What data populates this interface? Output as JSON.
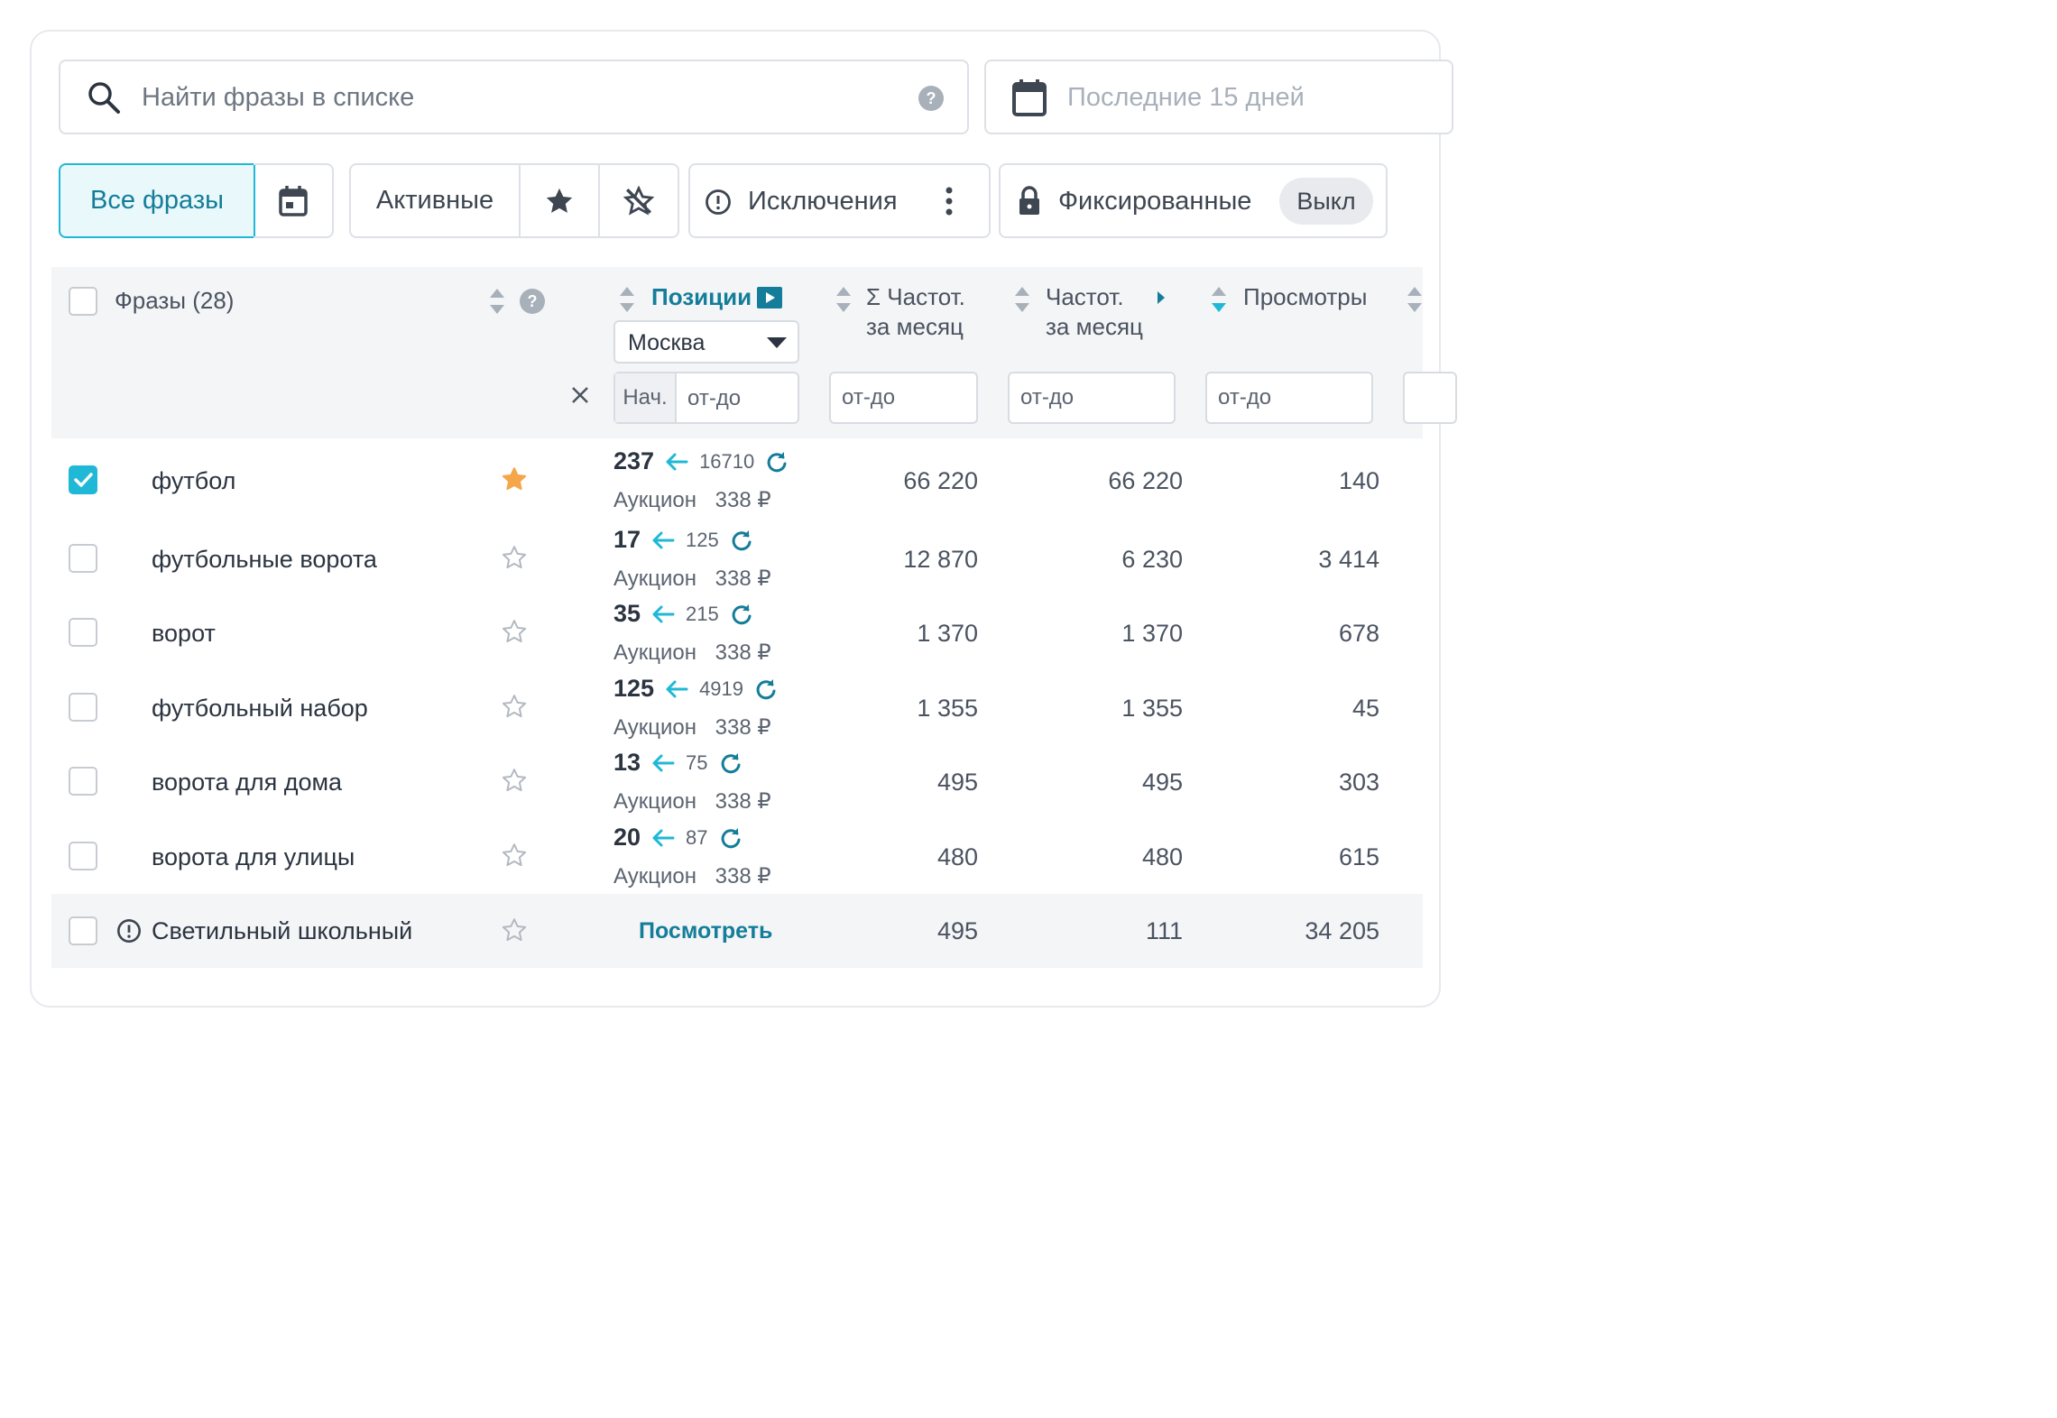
{
  "search": {
    "placeholder": "Найти фразы в списке"
  },
  "date_filter": {
    "label": "Последние 15 дней"
  },
  "filters": {
    "all_phrases": "Все фразы",
    "active": "Активные",
    "exclusions": "Исключения",
    "fixed": "Фиксированные",
    "fixed_state": "Выкл"
  },
  "colors": {
    "accent": "#147d9a",
    "cyan": "#1fb8d6",
    "star_active": "#f5a64a",
    "header_bg": "#f4f5f7"
  },
  "table": {
    "headers": {
      "phrases": "Фразы (28)",
      "positions": "Позиции",
      "region": "Москва",
      "start_label": "Нач.",
      "range_placeholder": "от-до",
      "freq_total_line1": "Σ Частот.",
      "freq_total_line2": "за месяц",
      "freq_line1": "Частот.",
      "freq_line2": "за месяц",
      "views": "Просмотры"
    },
    "rows": [
      {
        "phrase": "футбол",
        "checked": true,
        "starred": true,
        "pos": "237",
        "prev": "16710",
        "auction_label": "Аукцион",
        "auction_price": "338 ₽",
        "freq_total": "66 220",
        "freq": "66 220",
        "views": "140"
      },
      {
        "phrase": "футбольные ворота",
        "checked": false,
        "starred": false,
        "pos": "17",
        "prev": "125",
        "auction_label": "Аукцион",
        "auction_price": "338 ₽",
        "freq_total": "12 870",
        "freq": "6 230",
        "views": "3 414"
      },
      {
        "phrase": "ворот",
        "checked": false,
        "starred": false,
        "pos": "35",
        "prev": "215",
        "auction_label": "Аукцион",
        "auction_price": "338 ₽",
        "freq_total": "1 370",
        "freq": "1 370",
        "views": "678"
      },
      {
        "phrase": "футбольный набор",
        "checked": false,
        "starred": false,
        "pos": "125",
        "prev": "4919",
        "auction_label": "Аукцион",
        "auction_price": "338 ₽",
        "freq_total": "1 355",
        "freq": "1 355",
        "views": "45"
      },
      {
        "phrase": "ворота для дома",
        "checked": false,
        "starred": false,
        "pos": "13",
        "prev": "75",
        "auction_label": "Аукцион",
        "auction_price": "338 ₽",
        "freq_total": "495",
        "freq": "495",
        "views": "303"
      },
      {
        "phrase": "ворота для улицы",
        "checked": false,
        "starred": false,
        "pos": "20",
        "prev": "87",
        "auction_label": "Аукцион",
        "auction_price": "338 ₽",
        "freq_total": "480",
        "freq": "480",
        "views": "615"
      }
    ],
    "excluded_row": {
      "phrase": "Светильный школьный",
      "view_link": "Посмотреть",
      "freq_total": "495",
      "freq": "111",
      "views": "34 205"
    }
  }
}
